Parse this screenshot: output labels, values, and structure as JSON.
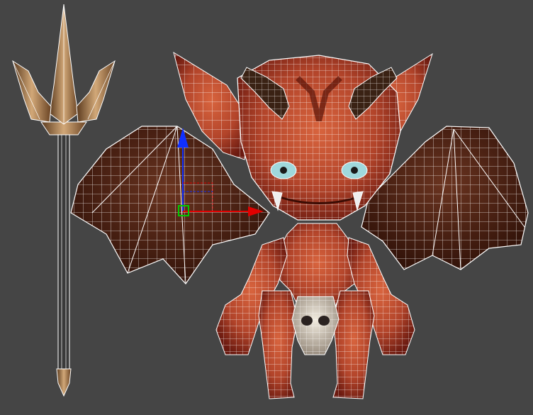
{
  "viewport": {
    "background": "#454545",
    "wireframe_color": "#ffffff",
    "axis_colors": {
      "x": "#e00000",
      "y": "#00cc00",
      "z": "#1030ff"
    }
  },
  "scene": {
    "objects": [
      "trident",
      "imp-demon"
    ],
    "colors": {
      "skin": "#b2442a",
      "skin_dark": "#6b1a10",
      "horn": "#3a2214",
      "wing": "#4a1e10",
      "metal": "#a07850",
      "skull": "#d8d0c0",
      "eye": "#9fd8dc"
    }
  },
  "gizmo": {
    "icon": "transform-gizmo-icon"
  }
}
